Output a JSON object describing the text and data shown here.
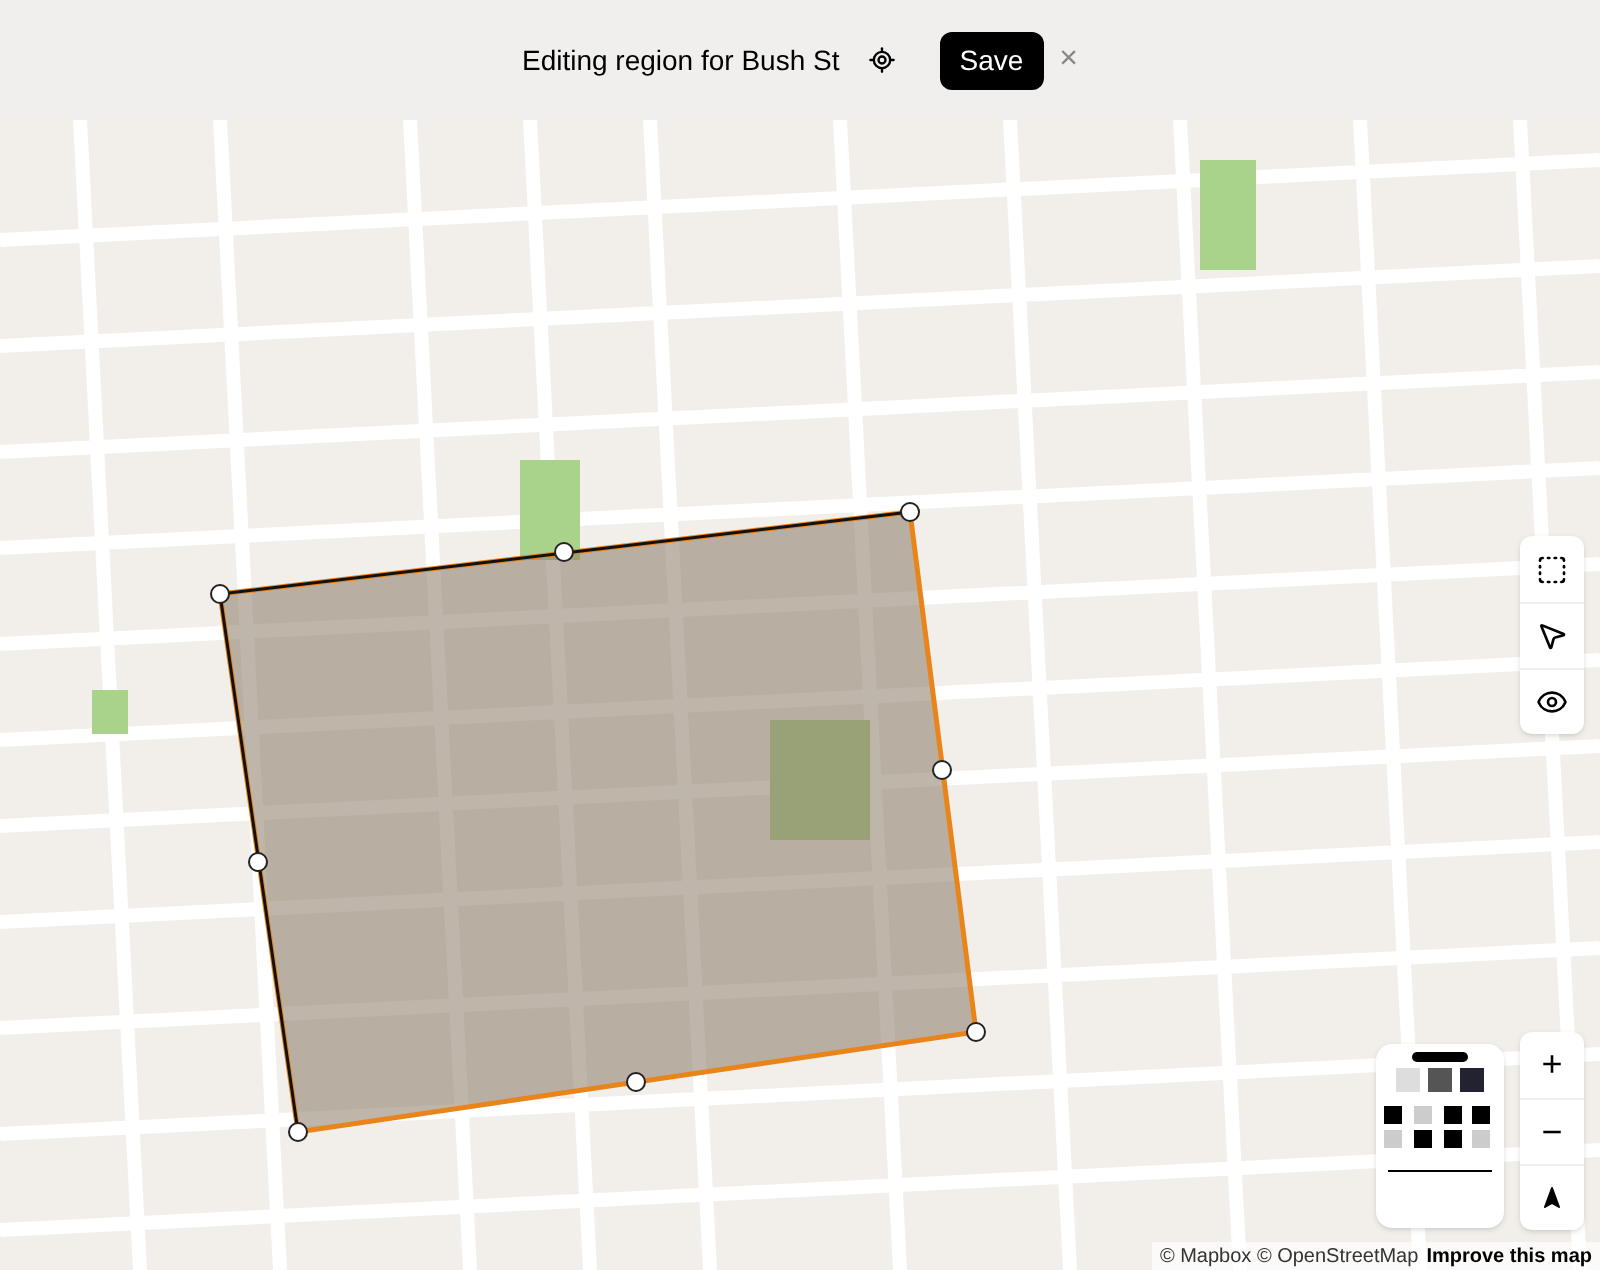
{
  "header": {
    "title": "Editing region for Bush St",
    "save_label": "Save",
    "close_label": "×"
  },
  "attribution": {
    "credits": "© Mapbox © OpenStreetMap",
    "link": "Improve this map"
  },
  "zoom_controls": [
    "+",
    "−"
  ]
}
